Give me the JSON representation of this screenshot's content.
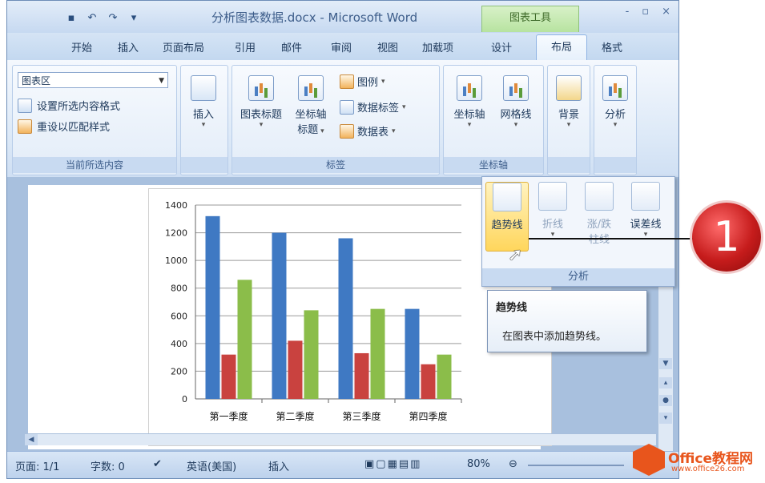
{
  "titlebar": {
    "doc_title": "分析图表数据.docx - Microsoft Word",
    "context_tool": "图表工具",
    "controls": [
      "-",
      "▫",
      "×"
    ]
  },
  "tabs": [
    "开始",
    "插入",
    "页面布局",
    "引用",
    "邮件",
    "审阅",
    "视图",
    "加载项",
    "设计",
    "布局",
    "格式"
  ],
  "active_tab": "布局",
  "ribbon": {
    "current_selection": {
      "combo_value": "图表区",
      "format_selection": "设置所选内容格式",
      "reset_style": "重设以匹配样式",
      "label": "当前所选内容"
    },
    "insert": {
      "label": "插入"
    },
    "labels_group": {
      "chart_title": "图表标题",
      "axis_title_1": "坐标轴",
      "axis_title_2": "标题",
      "legend": "图例",
      "data_labels": "数据标签",
      "data_table": "数据表",
      "label": "标签"
    },
    "axes_group": {
      "axes": "坐标轴",
      "gridlines": "网格线",
      "label": "坐标轴"
    },
    "background": {
      "label": "背景"
    },
    "analysis": {
      "label": "分析"
    }
  },
  "gallery": {
    "trendline": "趋势线",
    "lines": "折线",
    "updown_1": "涨/跌",
    "updown_2": "柱线",
    "error_bars": "误差线",
    "label": "分析"
  },
  "tooltip": {
    "title": "趋势线",
    "body": "在图表中添加趋势线。"
  },
  "callout": "1",
  "status": {
    "page": "页面: 1/1",
    "words": "字数: 0",
    "language": "英语(美国)",
    "insert_mode": "插入",
    "zoom": "80%"
  },
  "watermark": {
    "brand": "Office教程网",
    "url": "www.office26.com"
  },
  "chart_data": {
    "type": "bar",
    "categories": [
      "第一季度",
      "第二季度",
      "第三季度",
      "第四季度"
    ],
    "series": [
      {
        "values": [
          1320,
          1200,
          1160,
          650
        ],
        "color": "#3f79c3"
      },
      {
        "values": [
          320,
          420,
          330,
          250
        ],
        "color": "#c9423f"
      },
      {
        "values": [
          860,
          640,
          650,
          320
        ],
        "color": "#8bbd4a"
      }
    ],
    "ylim": [
      0,
      1400
    ],
    "yticks": [
      "0",
      "200",
      "400",
      "600",
      "800",
      "1000",
      "1200",
      "1400"
    ],
    "grid": true
  }
}
